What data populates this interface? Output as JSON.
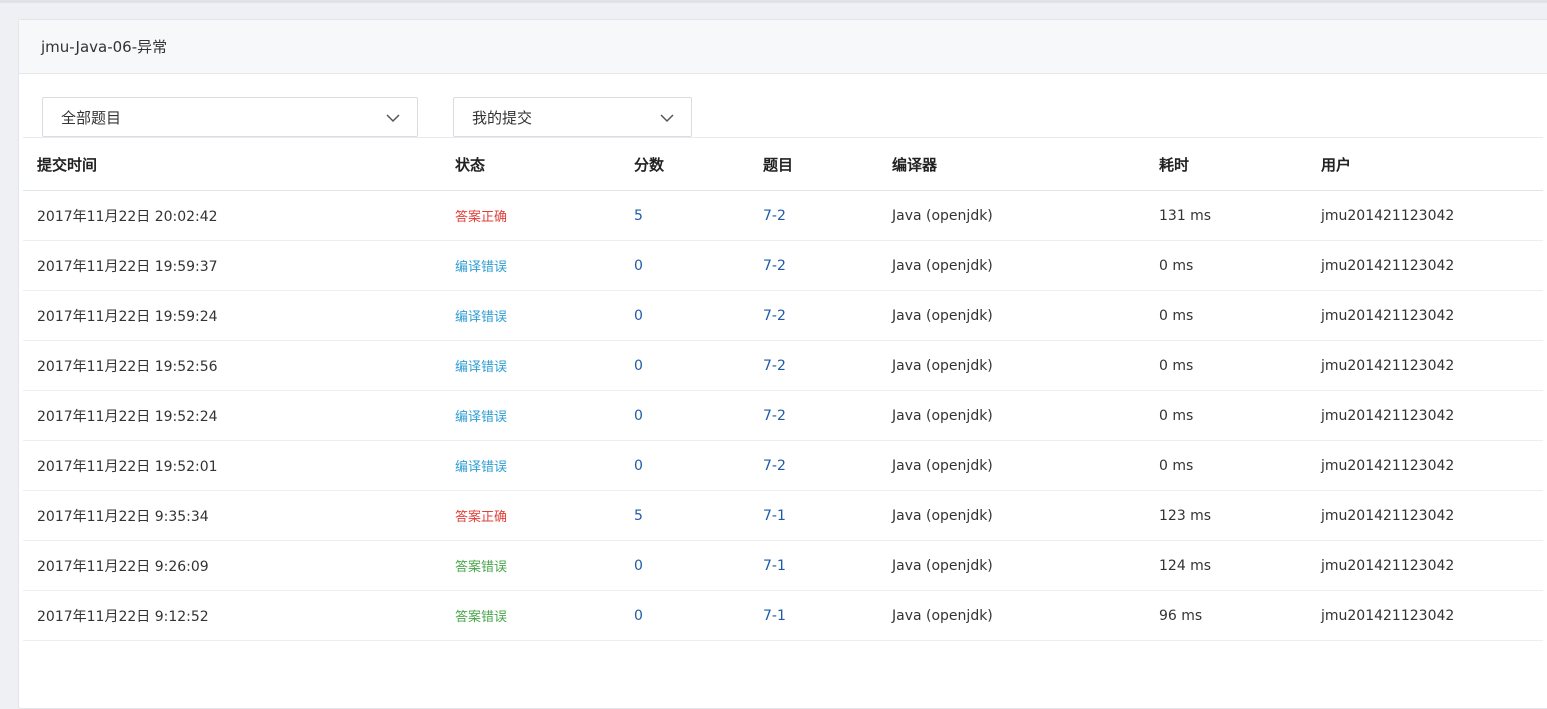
{
  "page": {
    "title": "jmu-Java-06-异常"
  },
  "filters": {
    "problem_select": "全部题目",
    "submit_select": "我的提交"
  },
  "colors": {
    "accepted": "#e0403a",
    "compile_error": "#2f9ed4",
    "wrong_answer": "#48a64b",
    "link": "#1e5aa8"
  },
  "table": {
    "headers": [
      "提交时间",
      "状态",
      "分数",
      "题目",
      "编译器",
      "耗时",
      "用户"
    ],
    "rows": [
      {
        "time": "2017年11月22日 20:02:42",
        "status": "答案正确",
        "status_type": "accepted",
        "score": "5",
        "problem": "7-2",
        "compiler": "Java (openjdk)",
        "duration": "131 ms",
        "user": "jmu201421123042"
      },
      {
        "time": "2017年11月22日 19:59:37",
        "status": "编译错误",
        "status_type": "compile_error",
        "score": "0",
        "problem": "7-2",
        "compiler": "Java (openjdk)",
        "duration": "0 ms",
        "user": "jmu201421123042"
      },
      {
        "time": "2017年11月22日 19:59:24",
        "status": "编译错误",
        "status_type": "compile_error",
        "score": "0",
        "problem": "7-2",
        "compiler": "Java (openjdk)",
        "duration": "0 ms",
        "user": "jmu201421123042"
      },
      {
        "time": "2017年11月22日 19:52:56",
        "status": "编译错误",
        "status_type": "compile_error",
        "score": "0",
        "problem": "7-2",
        "compiler": "Java (openjdk)",
        "duration": "0 ms",
        "user": "jmu201421123042"
      },
      {
        "time": "2017年11月22日 19:52:24",
        "status": "编译错误",
        "status_type": "compile_error",
        "score": "0",
        "problem": "7-2",
        "compiler": "Java (openjdk)",
        "duration": "0 ms",
        "user": "jmu201421123042"
      },
      {
        "time": "2017年11月22日 19:52:01",
        "status": "编译错误",
        "status_type": "compile_error",
        "score": "0",
        "problem": "7-2",
        "compiler": "Java (openjdk)",
        "duration": "0 ms",
        "user": "jmu201421123042"
      },
      {
        "time": "2017年11月22日 9:35:34",
        "status": "答案正确",
        "status_type": "accepted",
        "score": "5",
        "problem": "7-1",
        "compiler": "Java (openjdk)",
        "duration": "123 ms",
        "user": "jmu201421123042"
      },
      {
        "time": "2017年11月22日 9:26:09",
        "status": "答案错误",
        "status_type": "wrong_answer",
        "score": "0",
        "problem": "7-1",
        "compiler": "Java (openjdk)",
        "duration": "124 ms",
        "user": "jmu201421123042"
      },
      {
        "time": "2017年11月22日 9:12:52",
        "status": "答案错误",
        "status_type": "wrong_answer",
        "score": "0",
        "problem": "7-1",
        "compiler": "Java (openjdk)",
        "duration": "96 ms",
        "user": "jmu201421123042"
      }
    ]
  }
}
